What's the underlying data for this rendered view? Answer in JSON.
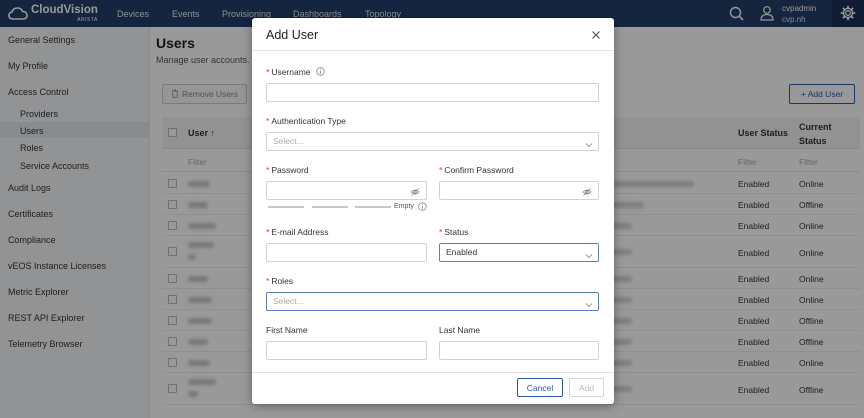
{
  "brand": {
    "name": "CloudVision",
    "sub": "ARISTA"
  },
  "nav": [
    "Devices",
    "Events",
    "Provisioning",
    "Dashboards",
    "Topology"
  ],
  "user": {
    "name": "cvpadmin",
    "host": "cvp.nh"
  },
  "sidebar": {
    "items": [
      "General Settings",
      "My Profile",
      "Access Control",
      "Audit Logs",
      "Certificates",
      "Compliance",
      "vEOS Instance Licenses",
      "Metric Explorer",
      "REST API Explorer",
      "Telemetry Browser"
    ],
    "access_children": [
      "Providers",
      "Users",
      "Roles",
      "Service Accounts"
    ]
  },
  "page": {
    "title": "Users",
    "subtitle": "Manage user accounts.",
    "remove_label": "Remove Users",
    "add_label": "+ Add User"
  },
  "table": {
    "headers": {
      "user": "User",
      "user_status": "User Status",
      "current_status_1": "Current",
      "current_status_2": "Status"
    },
    "filter": "Filter",
    "rows": [
      {
        "status": "Enabled",
        "current": "Online"
      },
      {
        "status": "Enabled",
        "current": "Offline"
      },
      {
        "status": "Enabled",
        "current": "Online"
      },
      {
        "status": "Enabled",
        "current": "Online"
      },
      {
        "status": "Enabled",
        "current": "Online"
      },
      {
        "status": "Enabled",
        "current": "Online"
      },
      {
        "status": "Enabled",
        "current": "Offline"
      },
      {
        "status": "Enabled",
        "current": "Offline"
      },
      {
        "status": "Enabled",
        "current": "Online"
      },
      {
        "status": "Enabled",
        "current": "Offline"
      }
    ]
  },
  "modal": {
    "title": "Add User",
    "username_label": "Username",
    "auth_label": "Authentication Type",
    "auth_placeholder": "Select...",
    "password_label": "Password",
    "confirm_label": "Confirm Password",
    "strength_text": "Empty",
    "email_label": "E-mail Address",
    "status_label": "Status",
    "status_value": "Enabled",
    "roles_label": "Roles",
    "roles_placeholder": "Select...",
    "first_name_label": "First Name",
    "last_name_label": "Last Name",
    "cancel_label": "Cancel",
    "add_label": "Add"
  },
  "colors": {
    "topbar": "#233f6b",
    "accent": "#2a5aa6",
    "required": "#d33"
  }
}
